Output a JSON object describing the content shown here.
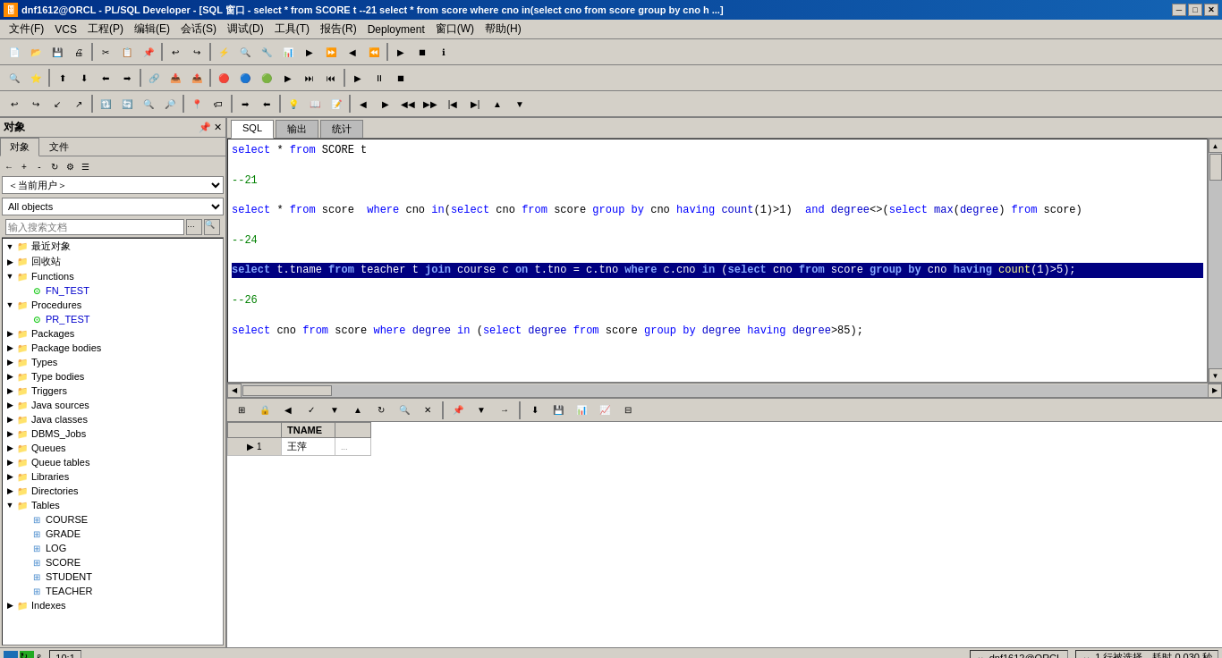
{
  "titlebar": {
    "title": "dnf1612@ORCL - PL/SQL Developer - [SQL 窗口 - select * from SCORE t --21 select * from score where cno in(select cno from score group by cno h ...]",
    "icon": "🗄"
  },
  "menubar": {
    "items": [
      "文件(F)",
      "VCS",
      "工程(P)",
      "编辑(E)",
      "会话(S)",
      "调试(D)",
      "工具(T)",
      "报告(R)",
      "Deployment",
      "窗口(W)",
      "帮助(H)"
    ]
  },
  "left_panel": {
    "title": "对象",
    "tabs": [
      "对象",
      "文件"
    ],
    "active_tab": "对象",
    "user_label": "＜当前用户＞",
    "object_filter": "All objects",
    "search_placeholder": "输入搜索文档",
    "toolbar_icons": [
      "←",
      "→",
      "+",
      "-",
      "⚙",
      "📋"
    ],
    "tree": [
      {
        "level": 0,
        "expanded": true,
        "type": "folder",
        "label": "最近对象"
      },
      {
        "level": 0,
        "expanded": false,
        "type": "folder",
        "label": "回收站"
      },
      {
        "level": 0,
        "expanded": true,
        "type": "folder",
        "label": "Functions"
      },
      {
        "level": 1,
        "type": "func",
        "label": "FN_TEST"
      },
      {
        "level": 0,
        "expanded": true,
        "type": "folder",
        "label": "Procedures"
      },
      {
        "level": 1,
        "type": "proc",
        "label": "PR_TEST"
      },
      {
        "level": 0,
        "expanded": false,
        "type": "folder",
        "label": "Packages"
      },
      {
        "level": 0,
        "expanded": false,
        "type": "folder",
        "label": "Package bodies"
      },
      {
        "level": 0,
        "expanded": false,
        "type": "folder",
        "label": "Types"
      },
      {
        "level": 0,
        "expanded": false,
        "type": "folder",
        "label": "Type bodies"
      },
      {
        "level": 0,
        "expanded": false,
        "type": "folder",
        "label": "Triggers"
      },
      {
        "level": 0,
        "expanded": false,
        "type": "folder",
        "label": "Java sources"
      },
      {
        "level": 0,
        "expanded": false,
        "type": "folder",
        "label": "Java classes"
      },
      {
        "level": 0,
        "expanded": false,
        "type": "folder",
        "label": "DBMS_Jobs"
      },
      {
        "level": 0,
        "expanded": false,
        "type": "folder",
        "label": "Queues"
      },
      {
        "level": 0,
        "expanded": false,
        "type": "folder",
        "label": "Queue tables"
      },
      {
        "level": 0,
        "expanded": false,
        "type": "folder",
        "label": "Libraries"
      },
      {
        "level": 0,
        "expanded": false,
        "type": "folder",
        "label": "Directories"
      },
      {
        "level": 0,
        "expanded": true,
        "type": "folder",
        "label": "Tables"
      },
      {
        "level": 1,
        "type": "table",
        "label": "COURSE"
      },
      {
        "level": 1,
        "type": "table",
        "label": "GRADE"
      },
      {
        "level": 1,
        "type": "table",
        "label": "LOG"
      },
      {
        "level": 1,
        "type": "table",
        "label": "SCORE"
      },
      {
        "level": 1,
        "type": "table",
        "label": "STUDENT"
      },
      {
        "level": 1,
        "type": "table",
        "label": "TEACHER"
      },
      {
        "level": 0,
        "expanded": false,
        "type": "folder",
        "label": "Indexes"
      }
    ]
  },
  "editor": {
    "tabs": [
      "SQL",
      "输出",
      "统计"
    ],
    "active_tab": "SQL",
    "lines": [
      {
        "type": "normal",
        "content": "select * from SCORE t"
      },
      {
        "type": "blank",
        "content": ""
      },
      {
        "type": "comment",
        "content": "--21"
      },
      {
        "type": "blank",
        "content": ""
      },
      {
        "type": "normal",
        "content": "select * from score  where cno in(select cno from score group by cno having count(1)>1)  and degree<>(select max(degree) from score)"
      },
      {
        "type": "blank",
        "content": ""
      },
      {
        "type": "comment",
        "content": "--24"
      },
      {
        "type": "blank",
        "content": ""
      },
      {
        "type": "highlighted",
        "content": "select t.tname from teacher t join course c on t.tno = c.tno where c.cno in (select cno from score group by cno having count(1)>5);"
      },
      {
        "type": "blank",
        "content": ""
      },
      {
        "type": "comment",
        "content": "--26"
      },
      {
        "type": "blank",
        "content": ""
      },
      {
        "type": "normal",
        "content": "select cno from score where degree in (select degree from score group by degree having degree>85);"
      }
    ]
  },
  "results": {
    "columns": [
      "TNAME"
    ],
    "rows": [
      {
        "num": 1,
        "tname": "王萍",
        "more": "..."
      }
    ]
  },
  "statusbar": {
    "position": "10:1",
    "connection": "dnf1612@ORCL",
    "rows_info": "1 行被选择，耗时 0.030 秒"
  }
}
